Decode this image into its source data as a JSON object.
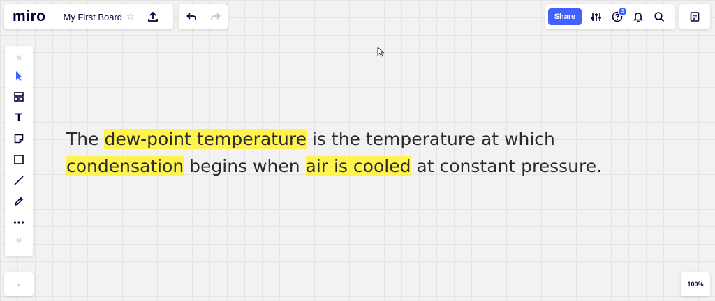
{
  "header": {
    "logo": "miro",
    "board_name": "My First Board",
    "share_label": "Share",
    "notification_count": "3"
  },
  "text_block": {
    "line1": [
      {
        "text": "The ",
        "highlight": false
      },
      {
        "text": "dew-point temperature",
        "highlight": true
      },
      {
        "text": " is the temperature at which",
        "highlight": false
      }
    ],
    "line2": [
      {
        "text": "condensation",
        "highlight": true
      },
      {
        "text": " begins when ",
        "highlight": false
      },
      {
        "text": "air is cooled",
        "highlight": true
      },
      {
        "text": " at constant pressure.",
        "highlight": false
      }
    ],
    "highlight_color": "#fff44f"
  },
  "zoom": "100%",
  "expand_label": "»",
  "colors": {
    "accent": "#4262ff",
    "canvas": "#f2f2f2",
    "ink": "#050038"
  }
}
